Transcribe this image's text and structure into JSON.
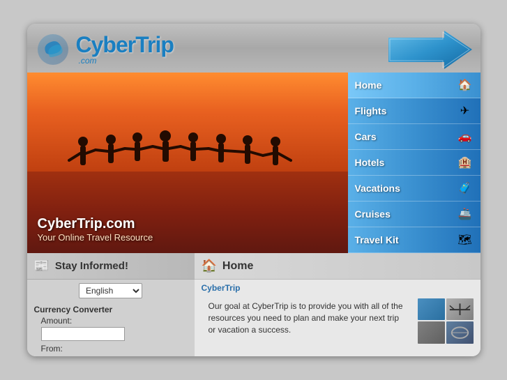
{
  "header": {
    "logo_cyber": "Cyber",
    "logo_trip": "Trip",
    "logo_com": ".com"
  },
  "hero": {
    "title": "CyberTrip.com",
    "subtitle": "Your Online Travel Resource"
  },
  "nav": {
    "items": [
      {
        "id": "home",
        "label": "Home",
        "icon": "🏠",
        "class": "nav-home"
      },
      {
        "id": "flights",
        "label": "Flights",
        "icon": "✈",
        "class": "nav-flights"
      },
      {
        "id": "cars",
        "label": "Cars",
        "icon": "🚗",
        "class": "nav-cars"
      },
      {
        "id": "hotels",
        "label": "Hotels",
        "icon": "🏨",
        "class": "nav-hotels"
      },
      {
        "id": "vacations",
        "label": "Vacations",
        "icon": "🧳",
        "class": "nav-vacations"
      },
      {
        "id": "cruises",
        "label": "Cruises",
        "icon": "🚢",
        "class": "nav-cruises"
      },
      {
        "id": "travelkit",
        "label": "Travel Kit",
        "icon": "🗺",
        "class": "nav-travelkit"
      }
    ]
  },
  "stay_informed": {
    "title": "Stay Informed!",
    "lang_default": "English"
  },
  "currency": {
    "title": "Currency Converter",
    "amount_label": "Amount:",
    "from_label": "From:"
  },
  "home_section": {
    "title": "Home",
    "brand": "CyberTrip",
    "description": "Our goal at CyberTrip is to provide you with all of the resources you need to plan and make your next trip or vacation a success."
  }
}
